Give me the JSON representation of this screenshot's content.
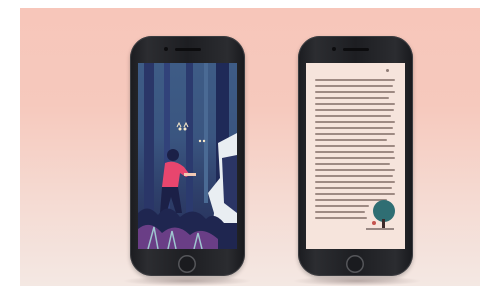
{
  "scene": {
    "background_color": "#f7c6ba",
    "background_bottom_color": "#f4e8e3"
  },
  "left_phone": {
    "frame_color": "#1d1e22",
    "screen": {
      "type": "illustration",
      "palette": {
        "sky": "#3e5c86",
        "trees": "#20284e",
        "figure_top": "#e8466e",
        "figure_skin": "#f2c9b3",
        "ground": "#1f2650",
        "accent": "#9fc6d0"
      }
    }
  },
  "right_phone": {
    "frame_color": "#1d1e22",
    "screen": {
      "type": "ebook-page",
      "page_color": "#f6e4dc",
      "text_color": "#9e8a83",
      "line_count": 24,
      "vignette": {
        "icon": "tree-illustration-icon",
        "color": "#2f6e73"
      }
    }
  }
}
